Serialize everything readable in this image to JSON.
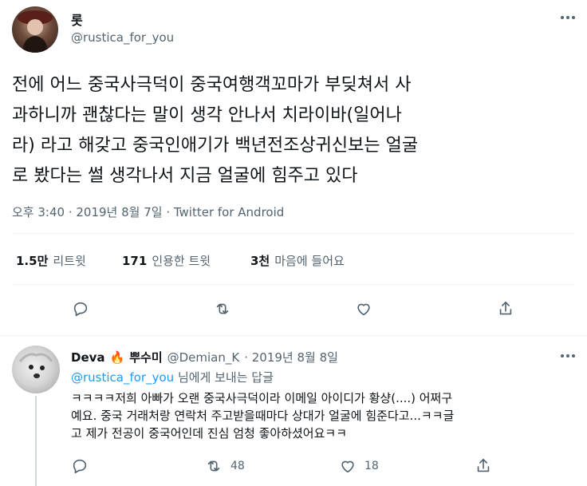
{
  "tweet": {
    "display_name": "롯",
    "handle": "@rustica_for_you",
    "body_lines": [
      "전에 어느 중국사극덕이 중국여행객꼬마가 부딪쳐서 사",
      "과하니까 괜찮다는 말이 생각 안나서 치라이바(일어나",
      "라) 라고 해갖고 중국인애기가 백년전조상귀신보는 얼굴",
      "로 봤다는 썰 생각나서 지금 얼굴에 힘주고 있다"
    ],
    "meta": "오후 3:40 · 2019년 8월 7일 · Twitter for Android",
    "stats": [
      {
        "num": "1.5만",
        "label": "리트윗"
      },
      {
        "num": "171",
        "label": "인용한 트윗"
      },
      {
        "num": "3천",
        "label": "마음에 들어요"
      }
    ]
  },
  "reply": {
    "display_name": "Deva",
    "emoji": "🔥",
    "name_suffix": "뿌수미",
    "handle": "@Demian_K",
    "date": "· 2019년 8월 8일",
    "reply_to_handle": "@rustica_for_you",
    "reply_to_suffix": "님에게 보내는 답글",
    "body_lines": [
      "ㅋㅋㅋㅋ저희 아빠가 오랜 중국사극덕이라 이메일 아이디가 황샹(....) 어쩌구",
      "예요. 중국 거래처랑 연락처 주고받을때마다 상대가 얼굴에 힘준다고...ㅋㅋ글",
      "고 제가 전공이 중국어인데 진심 엄청 좋아하셨어요ㅋㅋ"
    ],
    "retweet_count": "48",
    "like_count": "18"
  },
  "icons": [
    "more-icon",
    "reply-icon",
    "retweet-icon",
    "like-icon",
    "share-icon"
  ]
}
